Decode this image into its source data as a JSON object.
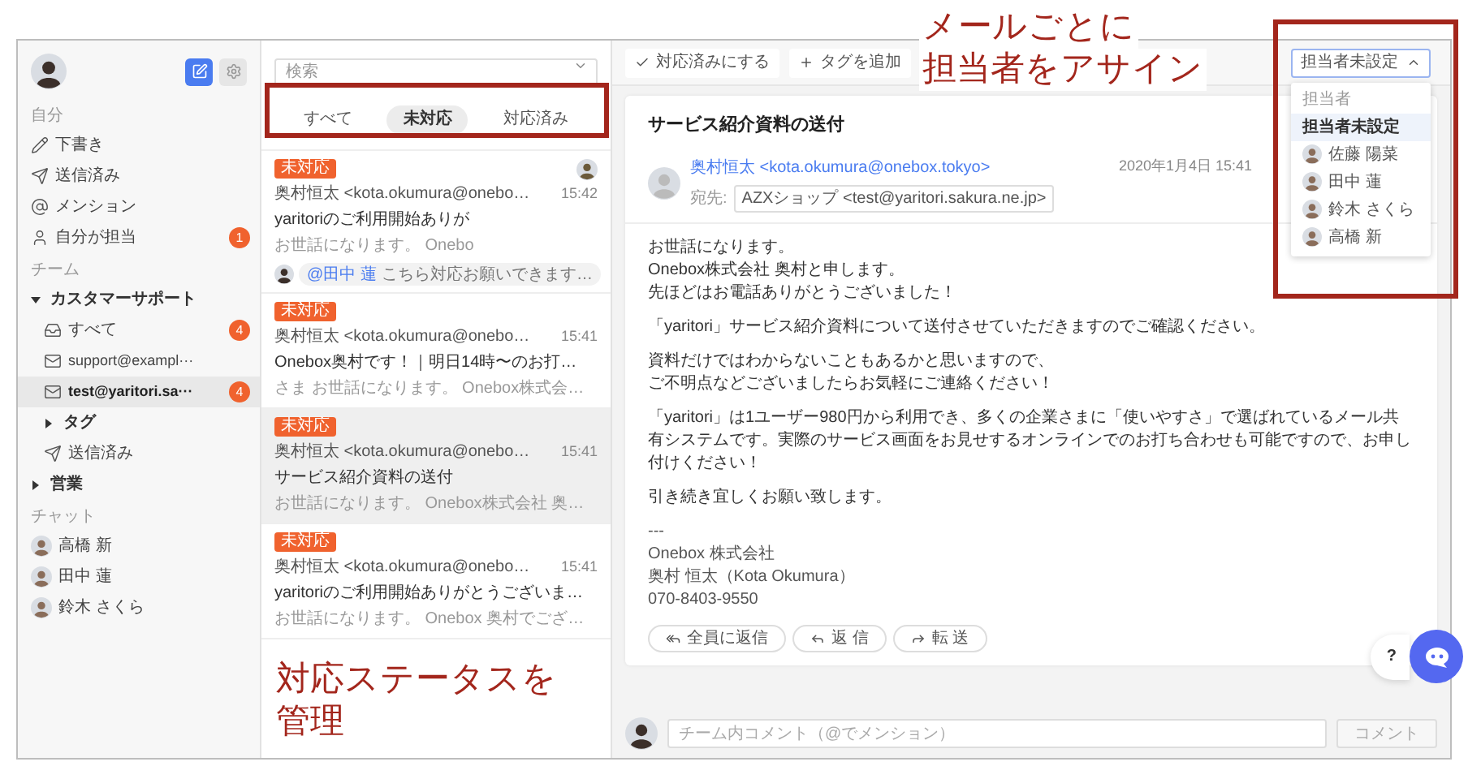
{
  "sidebar": {
    "sections": [
      {
        "title": "自分",
        "items": [
          {
            "kind": "draft",
            "label": "下書き",
            "selected": false
          },
          {
            "kind": "sent",
            "label": "送信済み",
            "selected": false
          },
          {
            "kind": "mention",
            "label": "メンション",
            "selected": false
          },
          {
            "kind": "assigned",
            "label": "自分が担当",
            "badge": "1",
            "selected": false
          }
        ]
      },
      {
        "title": "チーム",
        "items": [
          {
            "kind": "group",
            "label": "カスタマーサポート",
            "expanded": true,
            "children": [
              {
                "kind": "inbox",
                "label": "すべて",
                "badge": "4",
                "selected": false
              },
              {
                "kind": "mailbox",
                "label": "support@exampl···",
                "selected": false
              },
              {
                "kind": "mailbox",
                "label": "test@yaritori.sa···",
                "badge": "4",
                "selected": true
              },
              {
                "kind": "group",
                "label": "タグ",
                "expanded": false
              },
              {
                "kind": "sent",
                "label": "送信済み",
                "selected": false
              }
            ]
          },
          {
            "kind": "group",
            "label": "営業",
            "expanded": false
          }
        ]
      },
      {
        "title": "チャット",
        "items": [
          {
            "kind": "person",
            "label": "高橋 新",
            "selected": false
          },
          {
            "kind": "person",
            "label": "田中 蓮",
            "selected": false
          },
          {
            "kind": "person",
            "label": "鈴木 さくら",
            "selected": false
          }
        ]
      }
    ]
  },
  "list": {
    "search": {
      "placeholder": "検索"
    },
    "tabs": [
      {
        "label": "すべて",
        "selected": false
      },
      {
        "label": "未対応",
        "selected": true
      },
      {
        "label": "対応済み",
        "selected": false
      }
    ],
    "messages": [
      {
        "tag": "未対応",
        "from": "奥村恒太 <kota.okumura@onebo…",
        "time": "15:42",
        "subject": "yaritoriのご利用開始ありが",
        "preview": "お世話になります。 Onebo",
        "assigned": true,
        "selected": false,
        "comment": {
          "mention": "@田中 蓮",
          "text": "こちら対応お願いできます…"
        }
      },
      {
        "tag": "未対応",
        "from": "奥村恒太 <kota.okumura@onebo…",
        "time": "15:41",
        "subject": "Onebox奥村です！｜明日14時〜のお打…",
        "preview": "さま お世話になります。 Onebox株式会…",
        "assigned": false,
        "selected": false
      },
      {
        "tag": "未対応",
        "from": "奥村恒太 <kota.okumura@onebo…",
        "time": "15:41",
        "subject": "サービス紹介資料の送付",
        "preview": "お世話になります。 Onebox株式会社 奥…",
        "assigned": false,
        "selected": true
      },
      {
        "tag": "未対応",
        "from": "奥村恒太 <kota.okumura@onebo…",
        "time": "15:41",
        "subject": "yaritoriのご利用開始ありがとうございま…",
        "preview": "お世話になります。 Onebox 奥村でござ…",
        "assigned": false,
        "selected": false
      }
    ]
  },
  "detail": {
    "toolbar": [
      {
        "kind": "resolve",
        "label": "対応済みにする"
      },
      {
        "kind": "tag",
        "label": "タグを追加"
      }
    ],
    "assignee": {
      "value": "担当者未設定",
      "expanded": true,
      "menu_label": "担当者",
      "options": [
        {
          "label": "担当者未設定",
          "kind": "none",
          "selected": true
        },
        {
          "label": "佐藤 陽菜",
          "kind": "person",
          "selected": false
        },
        {
          "label": "田中 蓮",
          "kind": "person",
          "selected": false
        },
        {
          "label": "鈴木 さくら",
          "kind": "person",
          "selected": false
        },
        {
          "label": "高橋 新",
          "kind": "person",
          "selected": false
        }
      ]
    },
    "subject": "サービス紹介資料の送付",
    "sender": "奥村恒太 <kota.okumura@onebox.tokyo>",
    "to_label": "宛先:",
    "to": "AZXショップ <test@yaritori.sakura.ne.jp>",
    "date": "2020年1月4日 15:41",
    "body": [
      [
        "お世話になります。",
        "Onebox株式会社 奥村と申します。",
        "先ほどはお電話ありがとうございました！"
      ],
      [
        "「yaritori」サービス紹介資料について送付させていただきますのでご確認ください。"
      ],
      [
        "資料だけではわからないこともあるかと思いますので、",
        "ご不明点などございましたらお気軽にご連絡ください！"
      ],
      [
        "「yaritori」は1ユーザー980円から利用でき、多くの企業さまに「使いやすさ」で選ばれているメール共有システムです。実際のサービス画面をお見せするオンラインでのお打ち合わせも可能ですので、お申し付けください！"
      ],
      [
        "引き続き宜しくお願い致します。"
      ],
      [
        "---",
        "Onebox 株式会社",
        "奥村 恒太（Kota Okumura）",
        "070-8403-9550"
      ]
    ],
    "actions": [
      {
        "kind": "reply_all",
        "label": "全員に返信"
      },
      {
        "kind": "reply",
        "label": "返 信"
      },
      {
        "kind": "forward",
        "label": "転 送"
      }
    ],
    "comment": {
      "placeholder": "チーム内コメント（@でメンション）",
      "button": "コメント",
      "disabled": true
    },
    "help": "?"
  },
  "annotations": [
    {
      "lines": [
        "メールごとに",
        "担当者をアサイン"
      ]
    },
    {
      "lines": [
        "対応ステータスを",
        "管理"
      ]
    }
  ]
}
